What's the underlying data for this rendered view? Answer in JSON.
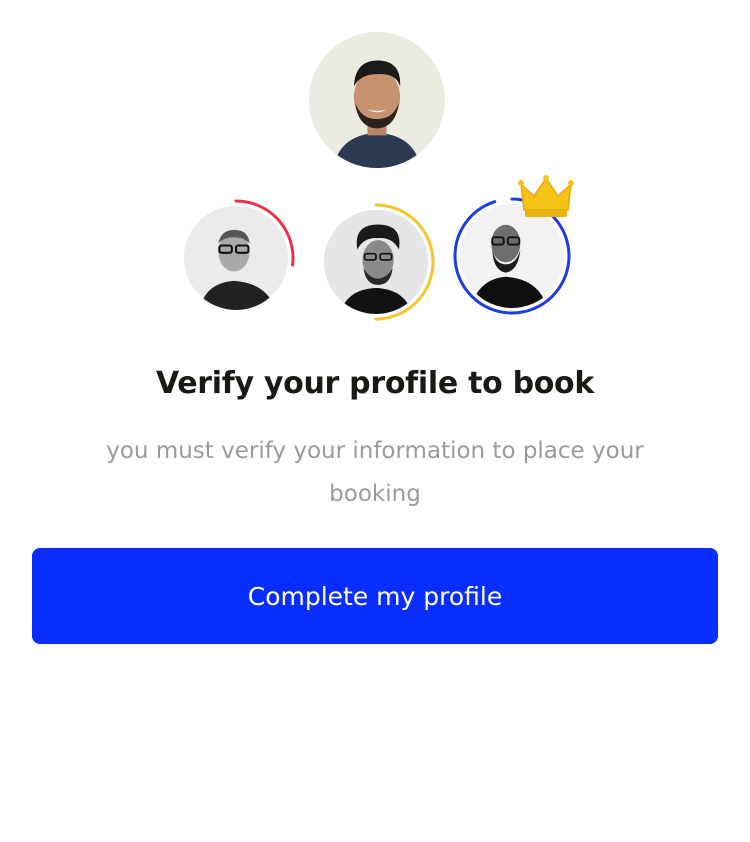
{
  "avatars": {
    "main": {
      "icon": "person-photo-avatar"
    },
    "secondary": [
      {
        "icon": "person-photo-avatar",
        "ring_color": "#e8344e",
        "progress": 0.27
      },
      {
        "icon": "person-photo-avatar",
        "ring_color": "#f2c62c",
        "progress": 0.5
      },
      {
        "icon": "person-photo-avatar",
        "ring_color": "#1d3de0",
        "progress": 0.95,
        "badge": "crown-icon"
      }
    ]
  },
  "content": {
    "title": "Verify your profile to book",
    "subtitle": "you must verify your information to place your booking"
  },
  "actions": {
    "primary_label": "Complete my profile"
  },
  "colors": {
    "primary": "#0a2eff",
    "title": "#1b1915",
    "subtitle": "#9a9a9a"
  }
}
